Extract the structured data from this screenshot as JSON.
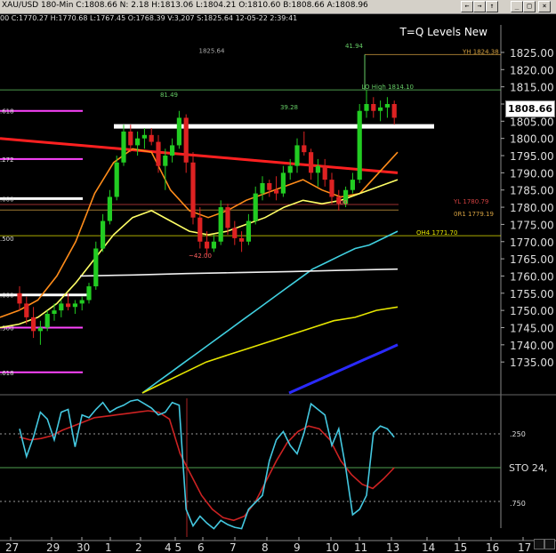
{
  "window": {
    "title": "XAU/USD  180-Min  C:1808.66  N:  2.18  H:1813.06  L:1804.21  O:1810.60  B:1808.66  A:1808.96",
    "sub": "00  C:1770.27  H:1770.68  L:1767.45  O:1768.39  V:3,207  S:1825.64  12-05-22  2:39:41",
    "buttons": [
      "←",
      "→",
      "↑",
      "_",
      "□",
      "×"
    ]
  },
  "chart_data": {
    "type": "candlestick",
    "title": "T=Q Levels New",
    "price_axis": {
      "ticks": [
        1825,
        1820,
        1815,
        1810,
        1805,
        1800,
        1795,
        1790,
        1785,
        1780,
        1775,
        1770,
        1765,
        1760,
        1755,
        1750,
        1745,
        1740,
        1735
      ],
      "ylim": [
        1726,
        1833
      ]
    },
    "current_price": "1808.66",
    "date_labels": [
      "27",
      "29",
      "30",
      "1",
      "2",
      "4 5",
      "6",
      "7",
      "8",
      "9",
      "10",
      "11",
      "13",
      "14",
      "15",
      "16",
      "17"
    ],
    "candles": [
      [
        1755,
        1757,
        1750,
        1752
      ],
      [
        1752,
        1754,
        1746,
        1748
      ],
      [
        1748,
        1751,
        1742,
        1744
      ],
      [
        1744,
        1747,
        1740,
        1745
      ],
      [
        1745,
        1750,
        1744,
        1749
      ],
      [
        1749,
        1752,
        1747,
        1750
      ],
      [
        1750,
        1753,
        1748,
        1752
      ],
      [
        1752,
        1755,
        1750,
        1751
      ],
      [
        1751,
        1753,
        1749,
        1752
      ],
      [
        1752,
        1754,
        1750,
        1753
      ],
      [
        1753,
        1758,
        1752,
        1757
      ],
      [
        1757,
        1770,
        1756,
        1768
      ],
      [
        1768,
        1778,
        1767,
        1776
      ],
      [
        1776,
        1785,
        1775,
        1783
      ],
      [
        1783,
        1795,
        1782,
        1793
      ],
      [
        1793,
        1804,
        1792,
        1802
      ],
      [
        1802,
        1804,
        1796,
        1798
      ],
      [
        1798,
        1802,
        1795,
        1800
      ],
      [
        1800,
        1803,
        1797,
        1801
      ],
      [
        1801,
        1803,
        1798,
        1799
      ],
      [
        1799,
        1801,
        1790,
        1792
      ],
      [
        1792,
        1797,
        1785,
        1795
      ],
      [
        1795,
        1800,
        1793,
        1798
      ],
      [
        1798,
        1808,
        1797,
        1806
      ],
      [
        1806,
        1807,
        1790,
        1793
      ],
      [
        1793,
        1796,
        1775,
        1777
      ],
      [
        1777,
        1780,
        1768,
        1770
      ],
      [
        1770,
        1773,
        1766,
        1768
      ],
      [
        1768,
        1772,
        1767,
        1770
      ],
      [
        1770,
        1782,
        1769,
        1780
      ],
      [
        1780,
        1781,
        1772,
        1774
      ],
      [
        1774,
        1776,
        1769,
        1771
      ],
      [
        1771,
        1773,
        1767,
        1770
      ],
      [
        1770,
        1778,
        1769,
        1776
      ],
      [
        1776,
        1786,
        1775,
        1784
      ],
      [
        1784,
        1789,
        1782,
        1787
      ],
      [
        1787,
        1788,
        1783,
        1785
      ],
      [
        1785,
        1789,
        1782,
        1784
      ],
      [
        1784,
        1792,
        1783,
        1790
      ],
      [
        1790,
        1794,
        1788,
        1792
      ],
      [
        1792,
        1800,
        1790,
        1798
      ],
      [
        1798,
        1802,
        1795,
        1796
      ],
      [
        1796,
        1797,
        1788,
        1790
      ],
      [
        1790,
        1794,
        1786,
        1792
      ],
      [
        1792,
        1794,
        1786,
        1788
      ],
      [
        1788,
        1790,
        1781,
        1783
      ],
      [
        1783,
        1785,
        1779,
        1781
      ],
      [
        1781,
        1786,
        1780,
        1785
      ],
      [
        1785,
        1790,
        1784,
        1788
      ],
      [
        1788,
        1810,
        1787,
        1808
      ],
      [
        1808,
        1814,
        1806,
        1810
      ],
      [
        1810,
        1812,
        1806,
        1808
      ],
      [
        1808,
        1811,
        1805,
        1809
      ],
      [
        1809,
        1812,
        1806,
        1810
      ],
      [
        1810,
        1811,
        1804,
        1806
      ]
    ],
    "moving_averages": [
      {
        "color": "#ff2020",
        "values": [
          1800,
          1799,
          1798,
          1797,
          1796,
          1795,
          1794,
          1793,
          1792,
          1791,
          1790
        ]
      },
      {
        "color": "#ff8c1a",
        "values": [
          1748,
          1750,
          1753,
          1760,
          1770,
          1784,
          1793,
          1797,
          1796,
          1785,
          1779,
          1777,
          1779,
          1782,
          1784,
          1786,
          1788,
          1785,
          1783,
          1784,
          1790,
          1796
        ]
      },
      {
        "color": "#ffff66",
        "values": [
          1745,
          1746,
          1748,
          1752,
          1758,
          1765,
          1772,
          1777,
          1779,
          1776,
          1773,
          1772,
          1773,
          1775,
          1777,
          1780,
          1782,
          1781,
          1782,
          1784,
          1786,
          1788
        ]
      },
      {
        "color": "#40d0e0",
        "values": [
          1726,
          1729,
          1732,
          1735,
          1738,
          1741,
          1744,
          1747,
          1750,
          1753,
          1756,
          1759,
          1762,
          1764,
          1766,
          1768,
          1769,
          1771,
          1773
        ]
      },
      {
        "color": "#f0f0f0",
        "values": [
          1760,
          1760.3,
          1760.7,
          1761,
          1761.3,
          1761.7,
          1762
        ]
      },
      {
        "color": "#e6e600",
        "values": [
          1726,
          1729,
          1732,
          1735,
          1737,
          1739,
          1741,
          1743,
          1745,
          1747,
          1748,
          1750,
          1751
        ]
      },
      {
        "color": "#2a2aff",
        "values": [
          1726,
          1728,
          1730,
          1732,
          1734,
          1736,
          1738,
          1740
        ]
      }
    ],
    "levels": [
      {
        "label": "LO High 1814.10",
        "value": 1814.1,
        "color": "#66cc66"
      },
      {
        "label": "YH 1824.38",
        "value": 1824.38,
        "color": "#d4a040"
      },
      {
        "label": "YL 1780.79",
        "value": 1780.79,
        "color": "#d04040"
      },
      {
        "label": "0R1 1779.19",
        "value": 1779.19,
        "color": "#d4a040"
      },
      {
        "label": "OH4 1771.70",
        "value": 1771.7,
        "color": "#e6e600"
      },
      {
        "label": "1825.64",
        "value": 1825.64,
        "color": "#aaaaaa"
      }
    ],
    "white_level": 1803.5,
    "annotations": [
      {
        "text": "41.94",
        "color": "#66cc66"
      },
      {
        "text": "81.49",
        "color": "#66cc66"
      },
      {
        "text": "39.28",
        "color": "#66cc66"
      },
      {
        "text": "~42.00",
        "color": "#ff6060"
      },
      {
        "text": ".00",
        "color": "#ff6060"
      }
    ],
    "left_edge_labels": [
      ".618",
      ".272",
      ".000",
      ".500",
      ".000",
      ".500",
      ".618"
    ],
    "oscillator": {
      "label": "STO  24,",
      "levels": [
        ".250",
        ".750"
      ],
      "k": [
        0.78,
        0.58,
        0.72,
        0.9,
        0.85,
        0.7,
        0.9,
        0.92,
        0.65,
        0.88,
        0.86,
        0.92,
        0.97,
        0.9,
        0.93,
        0.95,
        0.98,
        0.99,
        0.96,
        0.93,
        0.88,
        0.9,
        0.97,
        0.95,
        0.2,
        0.08,
        0.15,
        0.1,
        0.06,
        0.12,
        0.09,
        0.07,
        0.06,
        0.2,
        0.25,
        0.3,
        0.55,
        0.7,
        0.76,
        0.66,
        0.6,
        0.75,
        0.96,
        0.92,
        0.88,
        0.66,
        0.78,
        0.5,
        0.16,
        0.2,
        0.3,
        0.75,
        0.8,
        0.78,
        0.72
      ],
      "d": [
        0.72,
        0.7,
        0.71,
        0.73,
        0.77,
        0.8,
        0.83,
        0.86,
        0.87,
        0.88,
        0.89,
        0.9,
        0.91,
        0.9,
        0.85,
        0.6,
        0.45,
        0.3,
        0.2,
        0.14,
        0.12,
        0.15,
        0.25,
        0.4,
        0.55,
        0.68,
        0.76,
        0.8,
        0.78,
        0.7,
        0.55,
        0.45,
        0.38,
        0.35,
        0.42,
        0.5
      ]
    }
  }
}
